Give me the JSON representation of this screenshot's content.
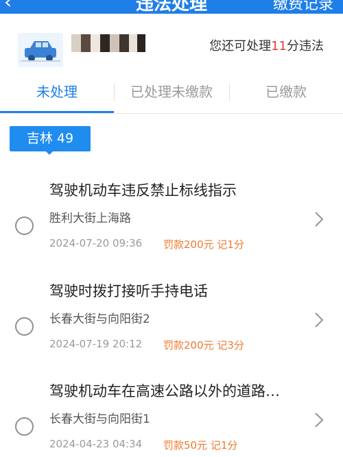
{
  "header": {
    "back_icon": "chevron-left-icon",
    "title": "违法处理",
    "action_label": "缴费记录"
  },
  "info": {
    "car_icon": "car-icon",
    "plate_masked": true,
    "remain_prefix": "您还可处理",
    "remain_count": "11",
    "remain_suffix": "分违法"
  },
  "tabs": [
    {
      "label": "未处理",
      "active": true
    },
    {
      "label": "已处理未缴款",
      "active": false
    },
    {
      "label": "已缴款",
      "active": false
    }
  ],
  "region": {
    "label": "吉林 49"
  },
  "violations": [
    {
      "title": "驾驶机动车违反禁止标线指示",
      "location": "胜利大街上海路",
      "time": "2024-07-20 09:36",
      "fine": "罚款200元 记1分"
    },
    {
      "title": "驾驶时拨打接听手持电话",
      "location": "长春大街与向阳街2",
      "time": "2024-07-19 20:12",
      "fine": "罚款200元 记3分"
    },
    {
      "title": "驾驶机动车在高速公路以外的道路…",
      "location": "长春大街与向阳街1",
      "time": "2024-04-23 04:34",
      "fine": "罚款50元 记1分"
    }
  ],
  "colors": {
    "accent": "#1f7ee8",
    "fine": "#f07a2e",
    "highlight": "#e53935"
  }
}
